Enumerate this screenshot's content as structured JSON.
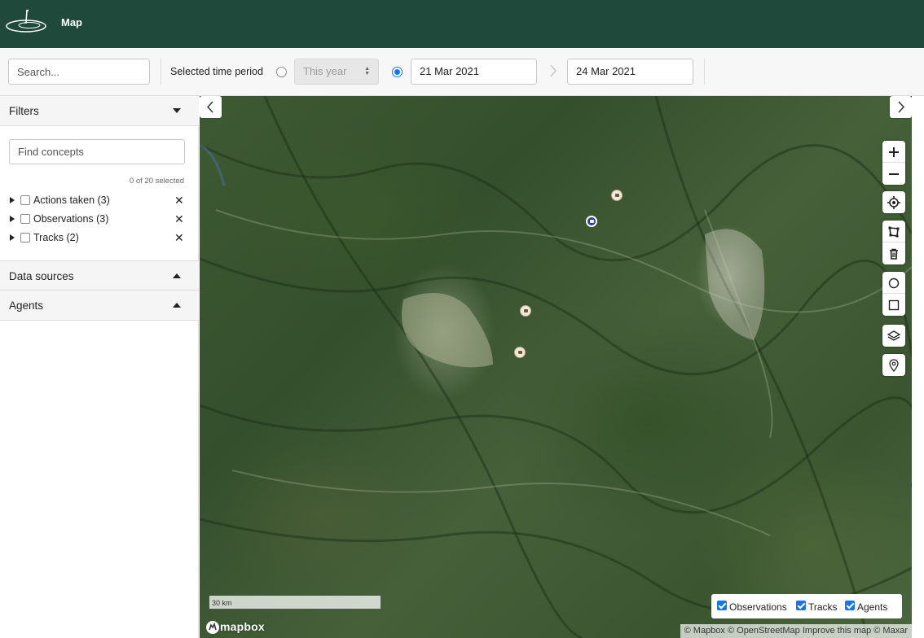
{
  "header": {
    "title": "Map"
  },
  "toolbar": {
    "search_placeholder": "Search...",
    "period_label": "Selected time period",
    "year_option": "This year",
    "date_from": "21 Mar 2021",
    "date_to": "24 Mar 2021",
    "range_selected": true
  },
  "sidebar": {
    "filters": {
      "title": "Filters",
      "find_placeholder": "Find concepts",
      "selected_count": "0 of 20 selected",
      "items": [
        {
          "label": "Actions taken (3)"
        },
        {
          "label": "Observations (3)"
        },
        {
          "label": "Tracks (2)"
        }
      ]
    },
    "data_sources": {
      "title": "Data sources"
    },
    "agents": {
      "title": "Agents"
    }
  },
  "map": {
    "scale": "30 km",
    "brand": "mapbox",
    "attribution": "© Mapbox © OpenStreetMap Improve this map © Maxar",
    "legend": [
      {
        "label": "Observations",
        "checked": true
      },
      {
        "label": "Tracks",
        "checked": true
      },
      {
        "label": "Agents",
        "checked": true
      }
    ],
    "controls": [
      "zoom-in-icon",
      "zoom-out-icon",
      "locate-icon",
      "draw-polygon-icon",
      "trash-icon",
      "circle-icon",
      "square-icon",
      "layers-icon",
      "pin-icon"
    ]
  },
  "colors": {
    "header_bg": "#1f4a3b",
    "accent": "#1a73e8"
  }
}
